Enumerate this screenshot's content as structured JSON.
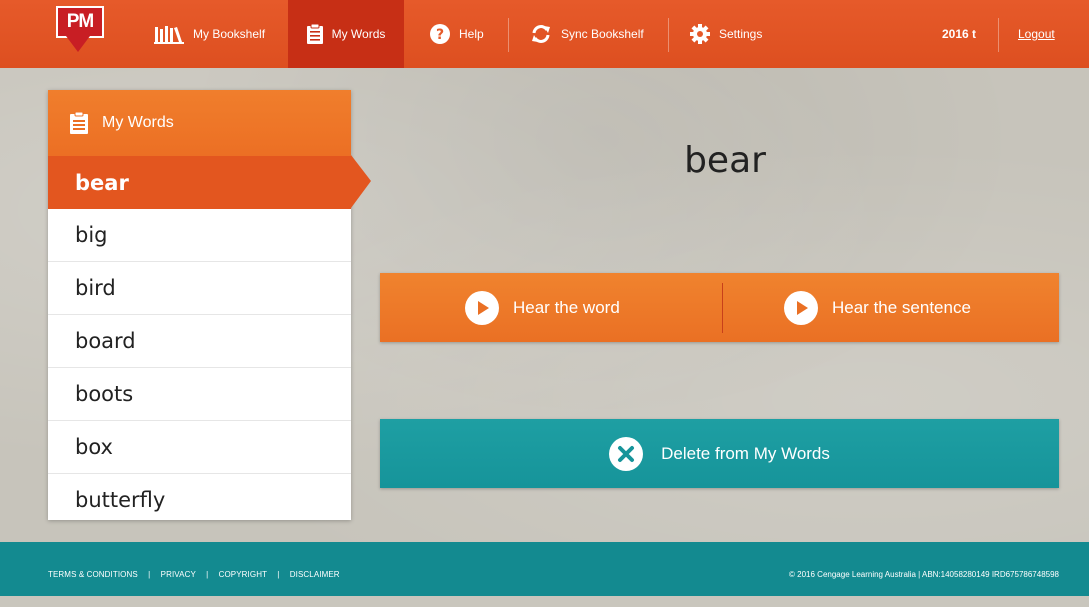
{
  "logo": {
    "text": "PM"
  },
  "nav": {
    "bookshelf": "My Bookshelf",
    "my_words": "My Words",
    "help": "Help",
    "sync": "Sync Bookshelf",
    "settings": "Settings",
    "user": "2016 t",
    "logout": "Logout"
  },
  "panel": {
    "title": "My Words",
    "words": [
      "bear",
      "big",
      "bird",
      "board",
      "boots",
      "box",
      "butterfly"
    ],
    "selected_index": 0
  },
  "main": {
    "word": "bear",
    "hear_word": "Hear the word",
    "hear_sentence": "Hear the sentence",
    "delete": "Delete from My Words"
  },
  "footer": {
    "terms": "TERMS & CONDITIONS",
    "privacy": "PRIVACY",
    "copyright_link": "COPYRIGHT",
    "disclaimer": "DISCLAIMER",
    "sep": "|",
    "copyright": "© 2016 Cengage Learning Australia | ABN:14058280149 IRD675786748598"
  },
  "colors": {
    "nav_orange": "#e65a2a",
    "nav_active": "#c72f15",
    "panel_orange": "#f07e2c",
    "selected": "#e3561f",
    "teal": "#1e9fa3",
    "footer_teal": "#138a90"
  },
  "icons": {
    "bookshelf": "bookshelf-icon",
    "my_words": "clipboard-icon",
    "help": "question-circle-icon",
    "sync": "sync-icon",
    "settings": "gear-icon",
    "play": "play-circle-icon",
    "delete": "close-circle-icon"
  }
}
